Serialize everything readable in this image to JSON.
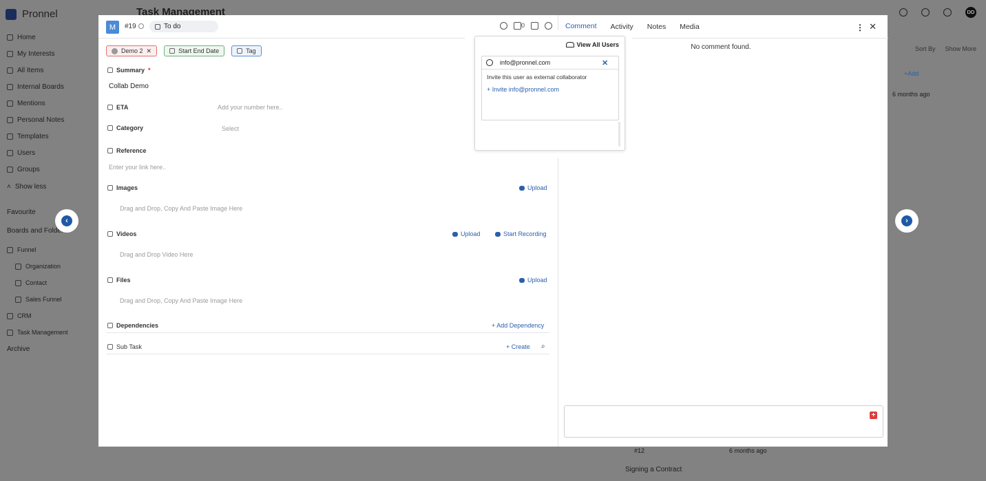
{
  "app": {
    "brand": "Pronnel",
    "page_title": "Task Management",
    "avatar_initials": "DO"
  },
  "sidebar": {
    "items": [
      {
        "label": "Home"
      },
      {
        "label": "My Interests"
      },
      {
        "label": "All Items"
      },
      {
        "label": "Internal Boards"
      },
      {
        "label": "Mentions"
      },
      {
        "label": "Personal Notes"
      },
      {
        "label": "Templates"
      },
      {
        "label": "Users"
      },
      {
        "label": "Groups"
      },
      {
        "label": "Show less"
      }
    ],
    "favourite": "Favourite",
    "boards_title": "Boards and Folders",
    "folders": [
      {
        "label": "Funnel"
      },
      {
        "label": "Organization"
      },
      {
        "label": "Contact"
      },
      {
        "label": "Sales Funnel"
      },
      {
        "label": "CRM"
      },
      {
        "label": "Task Management"
      }
    ],
    "archive": "Archive"
  },
  "background": {
    "sort_by": "Sort By",
    "show_more": "Show More",
    "add": "+Add",
    "time_ago": "6 months ago",
    "card_id": "#12",
    "card_time": "6 months ago",
    "card_title": "Signing a Contract"
  },
  "modal": {
    "badge_letter": "M",
    "task_id": "#19",
    "status": "To do",
    "counter": "0",
    "chips": {
      "user": "Demo 2",
      "dates": "Start End Date",
      "tag": "Tag"
    },
    "fields": {
      "summary_label": "Summary",
      "summary_required": "*",
      "summary_value": "Collab Demo",
      "eta_label": "ETA",
      "eta_placeholder": "Add your number here..",
      "category_label": "Category",
      "category_placeholder": "Select",
      "reference_label": "Reference",
      "reference_placeholder": "Enter your link here..",
      "images_label": "Images",
      "images_upload": "Upload",
      "images_drop": "Drag and Drop, Copy And Paste Image Here",
      "videos_label": "Videos",
      "videos_upload": "Upload",
      "videos_record": "Start Recording",
      "videos_drop": "Drag and Drop Video Here",
      "files_label": "Files",
      "files_upload": "Upload",
      "files_drop": "Drag and Drop, Copy And Paste Image Here",
      "dependencies_label": "Dependencies",
      "add_dependency": "+ Add Dependency",
      "subtask_label": "Sub Task",
      "create": "+ Create"
    },
    "tabs": [
      "Comment",
      "Activity",
      "Notes",
      "Media"
    ],
    "no_comment": "No comment found."
  },
  "popover": {
    "view_all": "View All Users",
    "search_value": "info@pronnel.com",
    "invite_note": "Invite this user as external collaborator",
    "invite_link": "+ Invite info@pronnel.com"
  }
}
